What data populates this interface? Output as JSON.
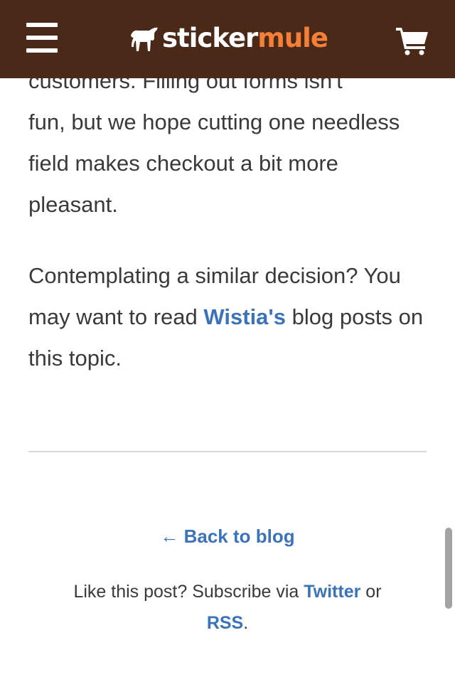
{
  "header": {
    "logo_text_white": "sticker",
    "logo_text_orange": "mule",
    "menu_icon": "hamburger-menu-icon",
    "cart_icon": "shopping-cart-icon",
    "brand_bg": "#4a2918",
    "brand_accent": "#f37f38"
  },
  "article": {
    "cut_line": "customers. Filling out forms isn't",
    "para1_rest": "fun, but we hope cutting one needless field makes checkout a bit more pleasant.",
    "para2_before": "Contemplating a similar decision? You may want to read ",
    "para2_link": "Wistia's",
    "para2_after": " blog posts on this topic.",
    "link_color": "#3b73b9"
  },
  "footer": {
    "back_link": "← Back to blog",
    "subscribe_before": "Like this post? Subscribe via ",
    "twitter_link": "Twitter",
    "subscribe_or": " or",
    "rss_link": "RSS",
    "subscribe_end": "."
  }
}
